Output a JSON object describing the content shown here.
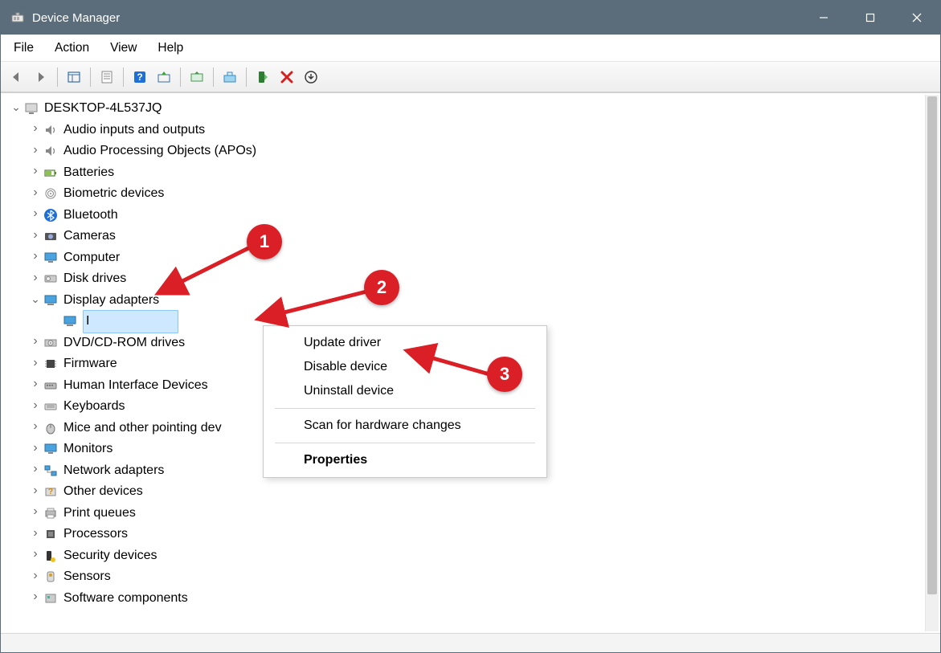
{
  "window": {
    "title": "Device Manager"
  },
  "menu": {
    "file": "File",
    "action": "Action",
    "view": "View",
    "help": "Help"
  },
  "tree": {
    "root": "DESKTOP-4L537JQ",
    "items": [
      "Audio inputs and outputs",
      "Audio Processing Objects (APOs)",
      "Batteries",
      "Biometric devices",
      "Bluetooth",
      "Cameras",
      "Computer",
      "Disk drives",
      "Display adapters",
      "DVD/CD-ROM drives",
      "Firmware",
      "Human Interface Devices",
      "Keyboards",
      "Mice and other pointing dev",
      "Monitors",
      "Network adapters",
      "Other devices",
      "Print queues",
      "Processors",
      "Security devices",
      "Sensors",
      "Software components"
    ],
    "selected_child": "I"
  },
  "context_menu": {
    "update": "Update driver",
    "disable": "Disable device",
    "uninstall": "Uninstall device",
    "scan": "Scan for hardware changes",
    "properties": "Properties"
  },
  "annotations": {
    "one": "1",
    "two": "2",
    "three": "3"
  }
}
